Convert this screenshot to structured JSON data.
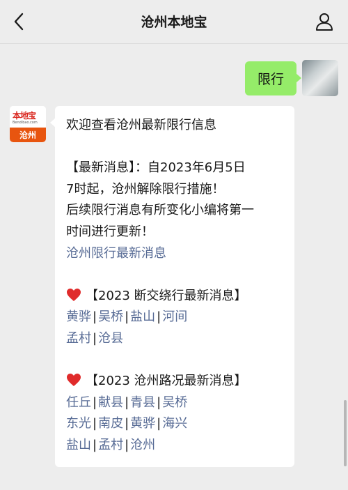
{
  "header": {
    "title": "沧州本地宝"
  },
  "outgoing": {
    "text": "限行"
  },
  "bot": {
    "logo_text": "本地宝",
    "logo_url": "Bendibao.com",
    "logo_city": "沧州"
  },
  "message": {
    "greeting": "欢迎查看沧州最新限行信息",
    "news_line1": "【最新消息】：自2023年6月5日",
    "news_line2": "7时起，沧州解除限行措施！",
    "news_line3": "后续限行消息有所变化小编将第一",
    "news_line4": "时间进行更新！",
    "latest_link": "沧州限行最新消息",
    "section1": {
      "title": "【2023 断交绕行最新消息】",
      "row1": [
        "黄骅",
        "吴桥",
        "盐山",
        "河间"
      ],
      "row2": [
        "孟村",
        "沧县"
      ]
    },
    "section2": {
      "title": "【2023 沧州路况最新消息】",
      "row1": [
        "任丘",
        "献县",
        "青县",
        "吴桥"
      ],
      "row2": [
        "东光",
        "南皮",
        "黄骅",
        "海兴"
      ],
      "row3": [
        "盐山",
        "孟村",
        "沧州"
      ]
    },
    "separator": "|"
  },
  "colors": {
    "background": "#ededed",
    "outgoing_bubble": "#95ec69",
    "link": "#576b95",
    "heart": "#e02b2b"
  },
  "icons": {
    "back": "chevron-left-icon",
    "profile": "person-icon",
    "heart": "heart-icon"
  }
}
